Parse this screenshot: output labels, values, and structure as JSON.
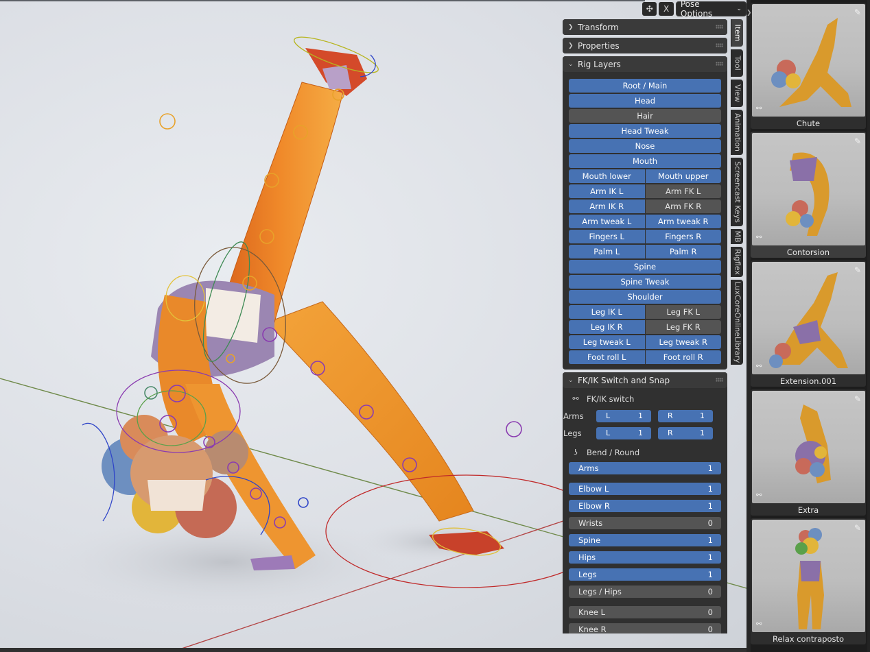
{
  "header": {
    "mode_icon": "bone-pose-icon",
    "x_label": "X",
    "pose_options_label": "Pose Options"
  },
  "panels": {
    "transform": {
      "title": "Transform"
    },
    "properties": {
      "title": "Properties"
    },
    "rig_layers": {
      "title": "Rig Layers",
      "rows": [
        [
          {
            "label": "Root / Main",
            "on": true
          }
        ],
        [
          {
            "label": "Head",
            "on": true
          }
        ],
        [
          {
            "label": "Hair",
            "on": false
          }
        ],
        [
          {
            "label": "Head Tweak",
            "on": true
          }
        ],
        [
          {
            "label": "Nose",
            "on": true
          }
        ],
        [
          {
            "label": "Mouth",
            "on": true
          }
        ],
        [
          {
            "label": "Mouth lower",
            "on": true
          },
          {
            "label": "Mouth upper",
            "on": true
          }
        ],
        [
          {
            "label": "Arm IK L",
            "on": true
          },
          {
            "label": "Arm FK L",
            "on": false
          }
        ],
        [
          {
            "label": "Arm IK R",
            "on": true
          },
          {
            "label": "Arm FK R",
            "on": false
          }
        ],
        [
          {
            "label": "Arm tweak L",
            "on": true
          },
          {
            "label": "Arm tweak R",
            "on": true
          }
        ],
        [
          {
            "label": "Fingers L",
            "on": true
          },
          {
            "label": "Fingers R",
            "on": true
          }
        ],
        [
          {
            "label": "Palm L",
            "on": true
          },
          {
            "label": "Palm R",
            "on": true
          }
        ],
        [
          {
            "label": "Spine",
            "on": true
          }
        ],
        [
          {
            "label": "Spine Tweak",
            "on": true
          }
        ],
        [
          {
            "label": "Shoulder",
            "on": true
          }
        ],
        [
          {
            "label": "Leg IK L",
            "on": true
          },
          {
            "label": "Leg FK L",
            "on": false
          }
        ],
        [
          {
            "label": "Leg IK R",
            "on": true
          },
          {
            "label": "Leg FK R",
            "on": false
          }
        ],
        [
          {
            "label": "Leg tweak L",
            "on": true
          },
          {
            "label": "Leg tweak R",
            "on": true
          }
        ],
        [
          {
            "label": "Foot roll L",
            "on": true
          },
          {
            "label": "Foot roll R",
            "on": true
          }
        ]
      ]
    },
    "fkik": {
      "title": "FK/IK Switch and Snap",
      "switch_label": "FK/IK switch",
      "arms_label": "Arms",
      "legs_label": "Legs",
      "arms_l": {
        "side": "L",
        "value": "1"
      },
      "arms_r": {
        "side": "R",
        "value": "1"
      },
      "legs_l": {
        "side": "L",
        "value": "1"
      },
      "legs_r": {
        "side": "R",
        "value": "1"
      },
      "bend_label": "Bend / Round",
      "fields": [
        {
          "label": "Arms",
          "value": "1",
          "on": true,
          "gap_after": true
        },
        {
          "label": "Elbow L",
          "value": "1",
          "on": true
        },
        {
          "label": "Elbow R",
          "value": "1",
          "on": true
        },
        {
          "label": "Wrists",
          "value": "0",
          "on": false
        },
        {
          "label": "Spine",
          "value": "1",
          "on": true
        },
        {
          "label": "Hips",
          "value": "1",
          "on": true
        },
        {
          "label": "Legs",
          "value": "1",
          "on": true
        },
        {
          "label": "Legs / Hips",
          "value": "0",
          "on": false,
          "gap_after": true
        },
        {
          "label": "Knee L",
          "value": "0",
          "on": false
        },
        {
          "label": "Knee R",
          "value": "0",
          "on": false
        }
      ]
    }
  },
  "tabs": [
    "Item",
    "Tool",
    "View",
    "Animation",
    "Screencast Keys",
    "MB",
    "Rigflex",
    "LuxCoreOnlineLibrary"
  ],
  "library": [
    {
      "name": "Chute",
      "selected": false
    },
    {
      "name": "Contorsion",
      "selected": true
    },
    {
      "name": "Extension.001",
      "selected": false
    },
    {
      "name": "Extra",
      "selected": false
    },
    {
      "name": "Relax contraposto",
      "selected": false
    }
  ],
  "colors": {
    "accent_blue": "#4772b3",
    "off_gray": "#545454",
    "panel_bg": "#303030"
  }
}
